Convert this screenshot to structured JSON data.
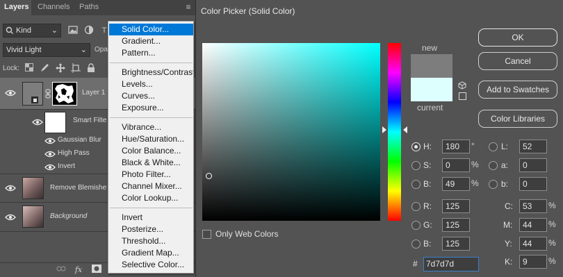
{
  "layers_panel": {
    "tabs": [
      "Layers",
      "Channels",
      "Paths"
    ],
    "filter_kind": "Kind",
    "blend_mode": "Vivid Light",
    "opacity_label": "Opa",
    "lock_label": "Lock:",
    "layers": [
      {
        "name": "Layer 1",
        "italic": false
      },
      {
        "name": "Smart Filte",
        "italic": false
      },
      {
        "name": "Remove Blemishe",
        "italic": false
      },
      {
        "name": "Background",
        "italic": true
      }
    ],
    "smart_filters": [
      "Gaussian Blur",
      "High Pass",
      "Invert"
    ]
  },
  "menu": {
    "groups": [
      [
        "Solid Color...",
        "Gradient...",
        "Pattern..."
      ],
      [
        "Brightness/Contrast...",
        "Levels...",
        "Curves...",
        "Exposure..."
      ],
      [
        "Vibrance...",
        "Hue/Saturation...",
        "Color Balance...",
        "Black & White...",
        "Photo Filter...",
        "Channel Mixer...",
        "Color Lookup..."
      ],
      [
        "Invert",
        "Posterize...",
        "Threshold...",
        "Gradient Map...",
        "Selective Color..."
      ]
    ],
    "selected": "Solid Color..."
  },
  "color_picker": {
    "title": "Color Picker (Solid Color)",
    "new_label": "new",
    "current_label": "current",
    "new_color": "#7d7d7d",
    "current_color": "#ddfffe",
    "buttons": {
      "ok": "OK",
      "cancel": "Cancel",
      "add_to_swatches": "Add to Swatches",
      "color_libraries": "Color Libraries"
    },
    "only_web_colors": "Only Web Colors",
    "hsb": {
      "H": "180",
      "S": "0",
      "B": "49"
    },
    "hsb_units": {
      "H": "°",
      "S": "%",
      "B": "%"
    },
    "rgb": {
      "R": "125",
      "G": "125",
      "B": "125"
    },
    "lab": {
      "L": "52",
      "a": "0",
      "b": "0"
    },
    "cmyk": {
      "C": "53",
      "M": "44",
      "Y": "44",
      "K": "9"
    },
    "cmyk_unit": "%",
    "hex_label": "#",
    "hex": "7d7d7d",
    "selected_field": "H"
  }
}
